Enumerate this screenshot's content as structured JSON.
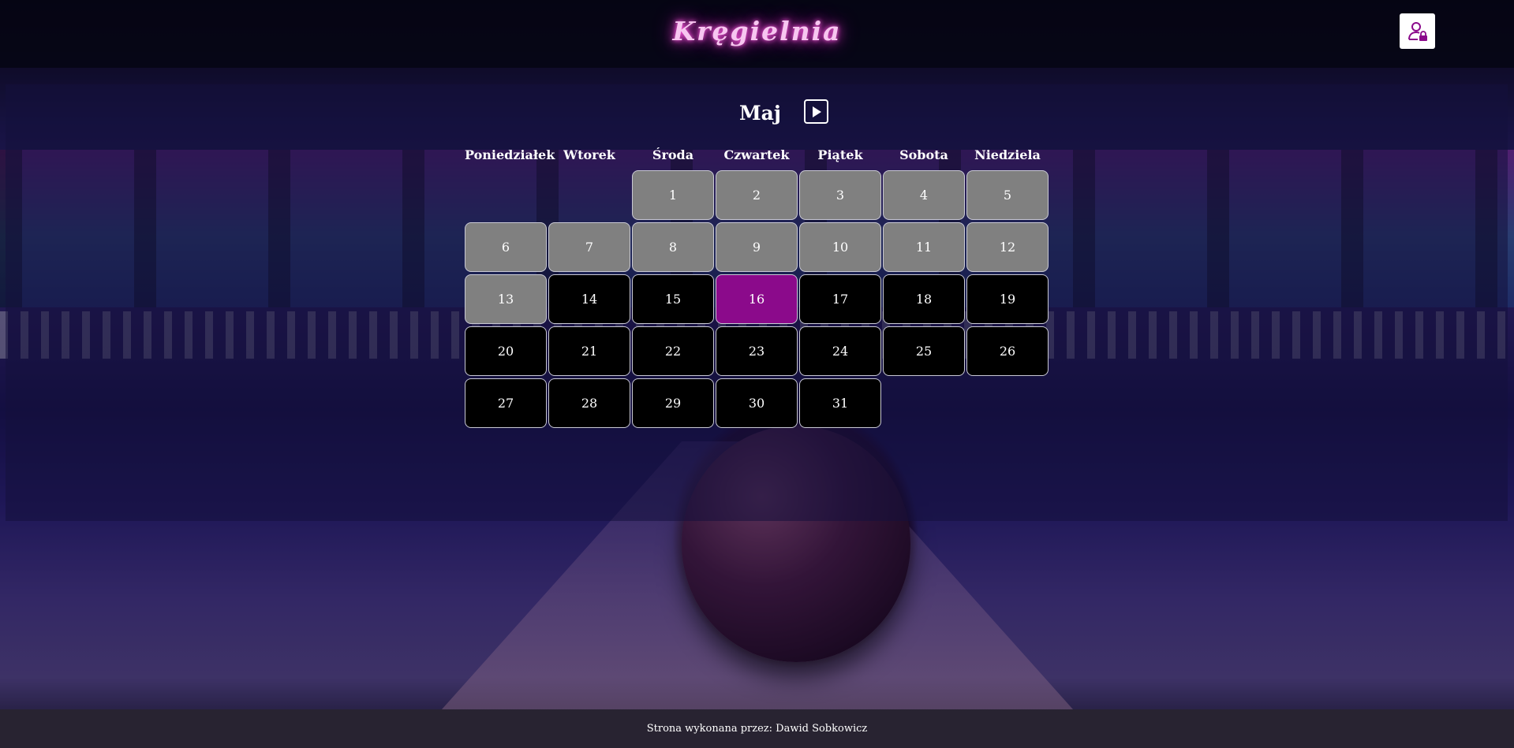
{
  "header": {
    "logo_text": "Kręgielnia",
    "login_icon": "user-lock-icon"
  },
  "calendar": {
    "month": "Maj",
    "next_icon": "play-icon",
    "weekdays": [
      "Poniedziałek",
      "Wtorek",
      "Środa",
      "Czwartek",
      "Piątek",
      "Sobota",
      "Niedziela"
    ],
    "first_weekday_index": 2,
    "days_in_month": 31,
    "today": 16,
    "last_past_day": 13,
    "colors": {
      "past": "#808080",
      "future": "#000000",
      "today": "#8b0a8b"
    }
  },
  "footer": {
    "text": "Strona wykonana przez: Dawid Sobkowicz"
  }
}
